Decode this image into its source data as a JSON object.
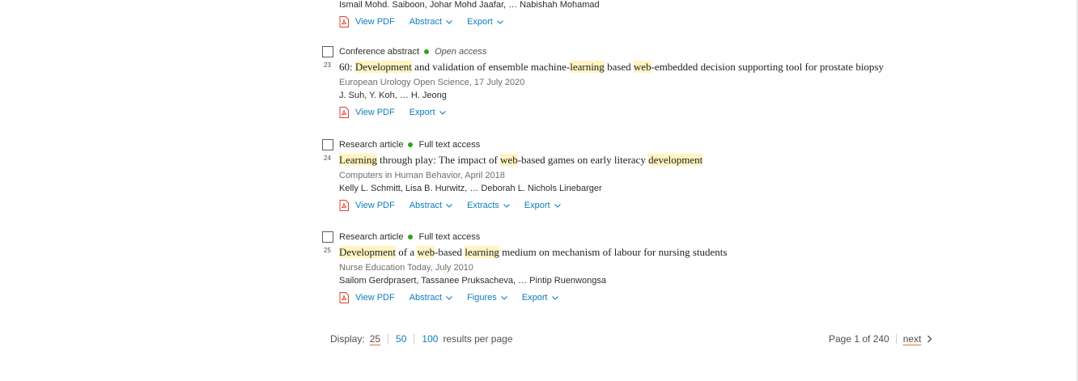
{
  "prev_result": {
    "authors": "Ismail Mohd. Saiboon, Johar Mohd Jaafar, … Nabishah Mohamad",
    "actions": [
      "View PDF",
      "Abstract",
      "Export"
    ]
  },
  "results": [
    {
      "number": "23",
      "type": "Conference abstract",
      "access": "Open access",
      "title": [
        "60: ",
        "Development",
        " and validation of ensemble machine-",
        "learning",
        " based ",
        "web",
        "-embedded decision supporting tool for prostate biopsy"
      ],
      "source": "European Urology Open Science, 17 July 2020",
      "authors": "J. Suh, Y. Koh, … H. Jeong",
      "actions": [
        "View PDF",
        "Export"
      ]
    },
    {
      "number": "24",
      "type": "Research article",
      "access": "Full text access",
      "title": [
        "Learning",
        " through play: The impact of ",
        "web",
        "-based games on early literacy ",
        "development"
      ],
      "source": "Computers in Human Behavior, April 2018",
      "authors": "Kelly L. Schmitt, Lisa B. Hurwitz, … Deborah L. Nichols Linebarger",
      "actions": [
        "View PDF",
        "Abstract",
        "Extracts",
        "Export"
      ]
    },
    {
      "number": "25",
      "type": "Research article",
      "access": "Full text access",
      "title": [
        "Development",
        " of a ",
        "web",
        "-based ",
        "learning",
        " medium on mechanism of labour for nursing students"
      ],
      "source": "Nurse Education Today, July 2010",
      "authors": "Sailom Gerdprasert, Tassanee Pruksacheva, … Pintip Ruenwongsa",
      "actions": [
        "View PDF",
        "Abstract",
        "Figures",
        "Export"
      ]
    }
  ],
  "display": {
    "label": "Display:",
    "options": [
      "25",
      "50",
      "100"
    ],
    "selected": "25",
    "suffix": "results per page"
  },
  "pagination": {
    "page_info": "Page 1 of 240",
    "next_label": "next"
  },
  "colors": {
    "link": "#0c7dbb",
    "highlight": "#fff4c2",
    "access_dot": "#29a61b",
    "underline_accent": "#e9711c"
  }
}
